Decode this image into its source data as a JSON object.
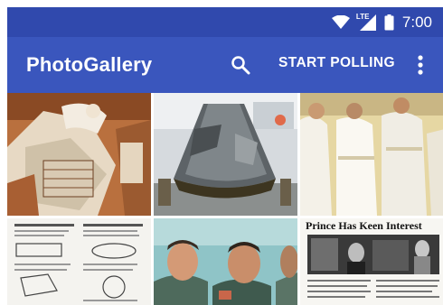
{
  "status_bar": {
    "time": "7:00",
    "network": "LTE",
    "icons": [
      "wifi-icon",
      "cell-signal-icon",
      "battery-icon"
    ]
  },
  "app_bar": {
    "title": "PhotoGallery",
    "start_polling_label": "START POLLING",
    "icons": [
      "search-icon",
      "overflow-menu-icon"
    ]
  },
  "colors": {
    "status_bar": "#3049ad",
    "app_bar": "#3a56bd",
    "text_on_primary": "#ffffff"
  },
  "gallery": {
    "photos": [
      {
        "name": "photo-spacecraft-interior"
      },
      {
        "name": "photo-apollo-capsule"
      },
      {
        "name": "photo-officers-in-white"
      },
      {
        "name": "photo-technical-diagram-page"
      },
      {
        "name": "photo-astronauts-smiling"
      },
      {
        "name": "photo-newspaper-clipping",
        "headline": "Prince Has Keen Interest"
      }
    ]
  }
}
